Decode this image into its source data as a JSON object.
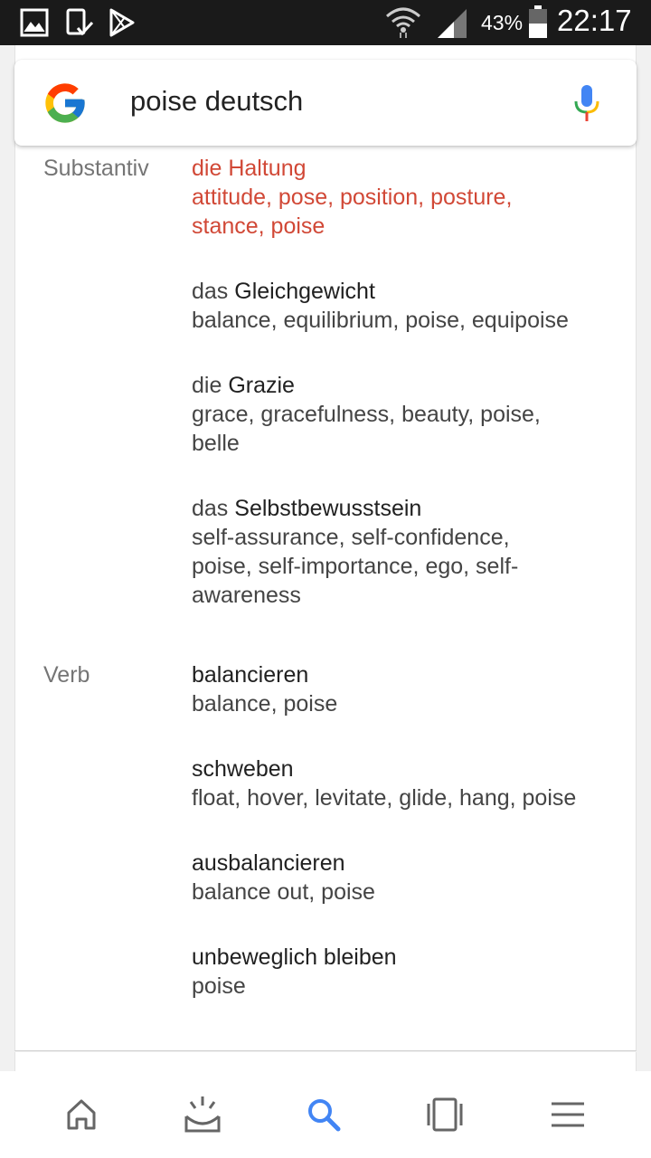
{
  "status_bar": {
    "battery": "43%",
    "time": "22:17"
  },
  "search": {
    "query": "poise deutsch"
  },
  "dictionary": {
    "noun_label": "Substantiv",
    "verb_label": "Verb",
    "nouns": [
      {
        "article": "die",
        "word": "Haltung",
        "synonyms_line1": "attitude, pose, position, posture,",
        "synonyms_line2": "stance, poise",
        "highlighted": true
      },
      {
        "article": "das",
        "word": "Gleichgewicht",
        "synonyms_line1": "balance, equilibrium, poise, equipoise",
        "synonyms_line2": ""
      },
      {
        "article": "die",
        "word": "Grazie",
        "synonyms_line1": "grace, gracefulness, beauty, poise,",
        "synonyms_line2": "belle"
      },
      {
        "article": "das",
        "word": "Selbstbewusstsein",
        "synonyms_line1": "self-assurance, self-confidence,",
        "synonyms_line2": "poise, self-importance, ego, self-",
        "synonyms_line3": "awareness"
      }
    ],
    "verbs": [
      {
        "word": "balancieren",
        "synonyms": "balance, poise"
      },
      {
        "word": "schweben",
        "synonyms": "float, hover, levitate, glide, hang, poise"
      },
      {
        "word": "ausbalancieren",
        "synonyms": "balance out, poise"
      },
      {
        "word": "unbeweglich bleiben",
        "synonyms": "poise"
      }
    ]
  },
  "bottom_nav": {
    "items": [
      "home-icon",
      "updates-icon",
      "search-icon",
      "recent-tabs-icon",
      "menu-icon"
    ],
    "active": "search-icon"
  },
  "colors": {
    "highlight": "#d14836",
    "active_nav": "#4285f4",
    "status_bar_bg": "#1a1a1a"
  }
}
